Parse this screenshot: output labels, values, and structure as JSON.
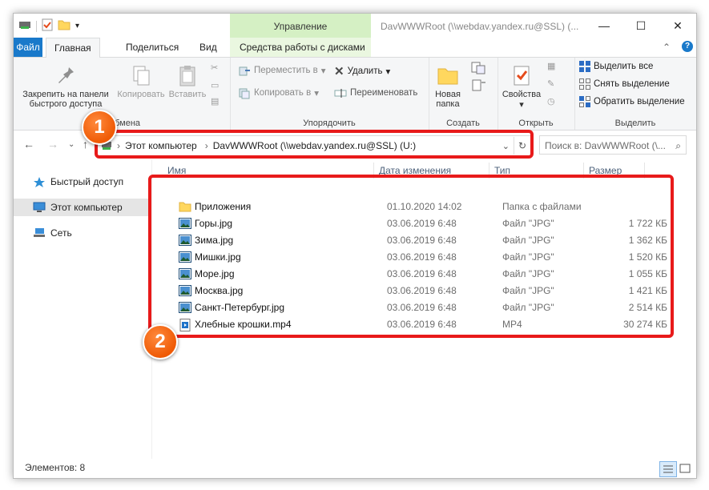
{
  "window": {
    "title": "DavWWWRoot (\\\\webdav.yandex.ru@SSL) (...",
    "context_tab": "Управление",
    "minimize": "—",
    "maximize": "☐",
    "close": "✕"
  },
  "tabs": {
    "file": "Файл",
    "home": "Главная",
    "share": "Поделиться",
    "view": "Вид",
    "drive_tools": "Средства работы с дисками",
    "help": "?"
  },
  "ribbon": {
    "clipboard": {
      "pin": "Закрепить на панели\nбыстрого доступа",
      "pin_line1": "Закрепить на панели",
      "pin_line2": "быстрого доступа",
      "copy": "Копировать",
      "paste": "Вставить",
      "label": "обмена"
    },
    "organize": {
      "move_to": "Переместить в",
      "copy_to": "Копировать в",
      "delete": "Удалить",
      "rename": "Переименовать",
      "label": "Упорядочить"
    },
    "new": {
      "new_folder_line1": "Новая",
      "new_folder_line2": "папка",
      "label": "Создать"
    },
    "open": {
      "properties": "Свойства",
      "label": "Открыть"
    },
    "select": {
      "select_all": "Выделить все",
      "select_none": "Снять выделение",
      "invert": "Обратить выделение",
      "label": "Выделить"
    }
  },
  "address": {
    "crumb1": "Этот компьютер",
    "crumb2": "DavWWWRoot (\\\\webdav.yandex.ru@SSL) (U:)",
    "search_placeholder": "Поиск в: DavWWWRoot (\\..."
  },
  "badges": {
    "one": "1",
    "two": "2"
  },
  "nav": {
    "quick_access": "Быстрый доступ",
    "this_pc": "Этот компьютер",
    "network": "Сеть"
  },
  "columns": {
    "name": "Имя",
    "date": "Дата изменения",
    "type": "Тип",
    "size": "Размер"
  },
  "files": [
    {
      "name": "Приложения",
      "date": "01.10.2020 14:02",
      "type": "Папка с файлами",
      "size": "",
      "icon": "folder-icon"
    },
    {
      "name": "Горы.jpg",
      "date": "03.06.2019 6:48",
      "type": "Файл \"JPG\"",
      "size": "1 722 КБ",
      "icon": "image-file-icon"
    },
    {
      "name": "Зима.jpg",
      "date": "03.06.2019 6:48",
      "type": "Файл \"JPG\"",
      "size": "1 362 КБ",
      "icon": "image-file-icon"
    },
    {
      "name": "Мишки.jpg",
      "date": "03.06.2019 6:48",
      "type": "Файл \"JPG\"",
      "size": "1 520 КБ",
      "icon": "image-file-icon"
    },
    {
      "name": "Море.jpg",
      "date": "03.06.2019 6:48",
      "type": "Файл \"JPG\"",
      "size": "1 055 КБ",
      "icon": "image-file-icon"
    },
    {
      "name": "Москва.jpg",
      "date": "03.06.2019 6:48",
      "type": "Файл \"JPG\"",
      "size": "1 421 КБ",
      "icon": "image-file-icon"
    },
    {
      "name": "Санкт-Петербург.jpg",
      "date": "03.06.2019 6:48",
      "type": "Файл \"JPG\"",
      "size": "2 514 КБ",
      "icon": "image-file-icon"
    },
    {
      "name": "Хлебные крошки.mp4",
      "date": "03.06.2019 6:48",
      "type": "MP4",
      "size": "30 274 КБ",
      "icon": "video-file-icon"
    }
  ],
  "status": {
    "count": "Элементов: 8"
  },
  "colors": {
    "accent": "#1979ca",
    "highlight": "#e81a1a",
    "badge": "#ef5a05",
    "context": "#d5f0c4"
  }
}
